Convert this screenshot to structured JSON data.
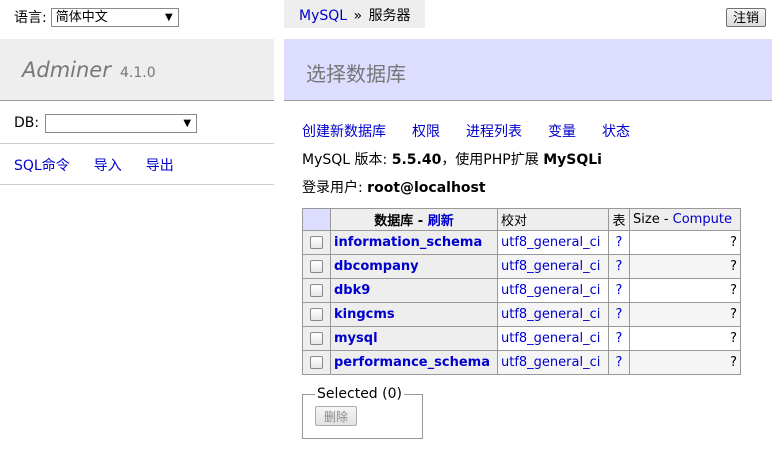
{
  "language": {
    "label": "语言:",
    "selected": "简体中文"
  },
  "app": {
    "name": "Adminer",
    "version": "4.1.0"
  },
  "db_select": {
    "label": "DB:",
    "selected": ""
  },
  "left_links": [
    {
      "label": "SQL命令"
    },
    {
      "label": "导入"
    },
    {
      "label": "导出"
    }
  ],
  "breadcrumb": {
    "driver": "MySQL",
    "separator": "»",
    "current": "服务器"
  },
  "logout_label": "注销",
  "page_title": "选择数据库",
  "menu": [
    {
      "label": "创建新数据库"
    },
    {
      "label": "权限"
    },
    {
      "label": "进程列表"
    },
    {
      "label": "变量"
    },
    {
      "label": "状态"
    }
  ],
  "version_line": {
    "prefix": "MySQL 版本:",
    "version": "5.5.40",
    "middle": "，使用PHP扩展",
    "extension": "MySQLi"
  },
  "login_line": {
    "prefix": "登录用户:",
    "user": "root@localhost"
  },
  "table": {
    "headers": {
      "database": "数据库",
      "dash": " - ",
      "refresh": "刷新",
      "collation": "校对",
      "tables": "表",
      "size": "Size",
      "compute": "Compute"
    },
    "rows": [
      {
        "name": "information_schema",
        "collation": "utf8_general_ci",
        "tables": "?",
        "size": "?"
      },
      {
        "name": "dbcompany",
        "collation": "utf8_general_ci",
        "tables": "?",
        "size": "?"
      },
      {
        "name": "dbk9",
        "collation": "utf8_general_ci",
        "tables": "?",
        "size": "?"
      },
      {
        "name": "kingcms",
        "collation": "utf8_general_ci",
        "tables": "?",
        "size": "?"
      },
      {
        "name": "mysql",
        "collation": "utf8_general_ci",
        "tables": "?",
        "size": "?"
      },
      {
        "name": "performance_schema",
        "collation": "utf8_general_ci",
        "tables": "?",
        "size": "?"
      }
    ]
  },
  "selected": {
    "legend": "Selected (0)",
    "delete_label": "删除"
  }
}
